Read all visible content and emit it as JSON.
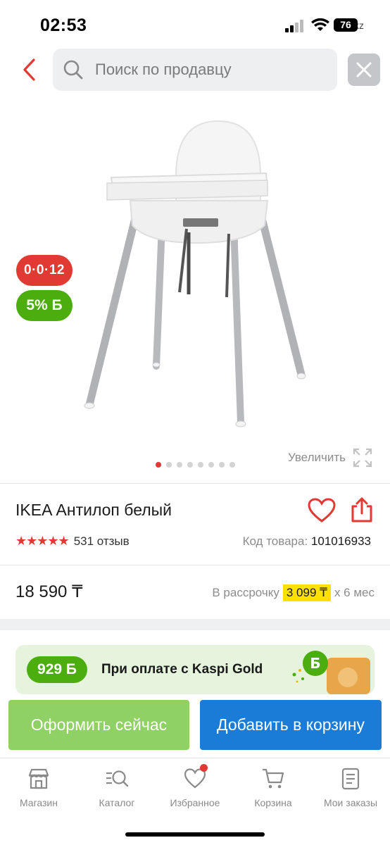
{
  "status_bar": {
    "time": "02:53",
    "battery": "76",
    "url_tail": "i.kz"
  },
  "header": {
    "search_placeholder": "Поиск по продавцу"
  },
  "product": {
    "badge_installment": "0·0·12",
    "badge_bonus": "5% Б",
    "zoom_label": "Увеличить",
    "image_count": 8,
    "active_image": 0,
    "title": "IKEA Антилоп белый",
    "rating": 5,
    "reviews": "531 отзыв",
    "sku_label": "Код товара:",
    "sku_value": "101016933",
    "price": "18 590 ₸",
    "installment_prefix": "В рассрочку",
    "installment_amount": "3 099 ₸",
    "installment_suffix": "х 6 мес"
  },
  "kaspi_gold": {
    "bonus": "929 Б",
    "text": "При оплате с Kaspi Gold"
  },
  "actions": {
    "buy_now": "Оформить сейчас",
    "add_to_cart": "Добавить в корзину"
  },
  "bottom_nav": [
    {
      "label": "Магазин",
      "icon": "store-icon"
    },
    {
      "label": "Каталог",
      "icon": "catalog-search-icon"
    },
    {
      "label": "Избранное",
      "icon": "heart-icon"
    },
    {
      "label": "Корзина",
      "icon": "cart-icon"
    },
    {
      "label": "Мои заказы",
      "icon": "orders-icon"
    }
  ],
  "colors": {
    "accent_red": "#e03a33",
    "kaspi_green": "#4cad0f",
    "cart_blue": "#1a7cd6",
    "buy_green": "#90d165",
    "installment_yellow": "#ffe100"
  }
}
